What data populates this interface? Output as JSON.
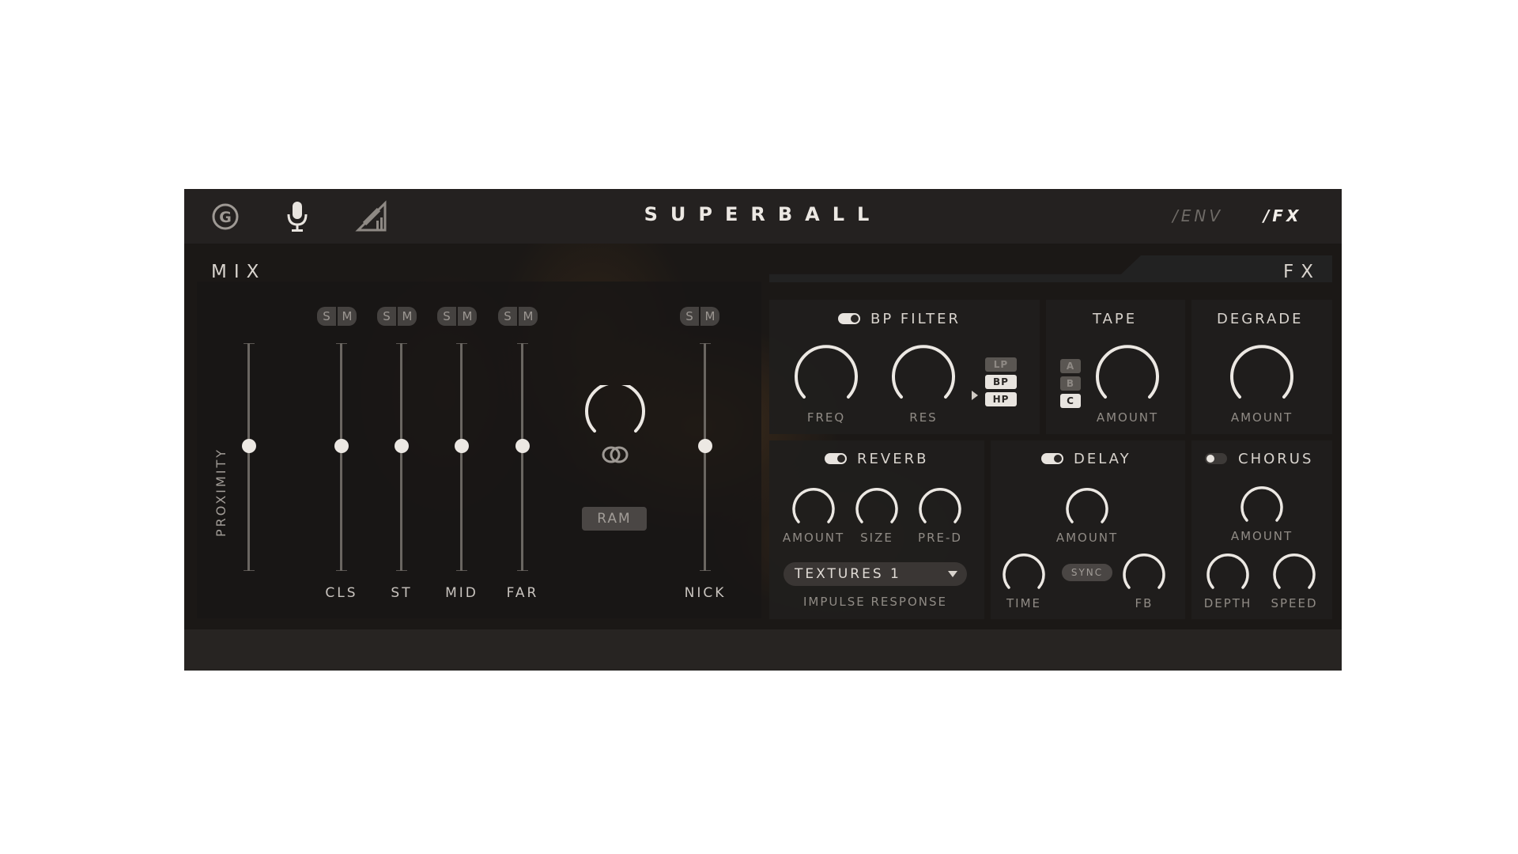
{
  "header": {
    "title": "SUPERBALL",
    "logo_icon": "g-logo-icon",
    "mic_icon": "microphone-icon",
    "tool_icon": "pencil-ruler-icon",
    "nav": [
      "/ENV",
      "/FX"
    ],
    "active_nav": "/FX"
  },
  "mix": {
    "title": "MIX",
    "proximity_label": "PROXIMITY",
    "solo_label": "S",
    "mute_label": "M",
    "faders": [
      {
        "label": "CLS",
        "level": 0.56
      },
      {
        "label": "ST",
        "level": 0.56
      },
      {
        "label": "MID",
        "level": 0.56
      },
      {
        "label": "FAR",
        "level": 0.56
      },
      {
        "label": "NICK",
        "level": 0.56
      }
    ],
    "proximity_level": 0.56,
    "ram_label": "RAM"
  },
  "fx": {
    "title": "FX",
    "bp_filter": {
      "title": "BP FILTER",
      "enabled": true,
      "knobs": [
        "FREQ",
        "RES"
      ],
      "modes": [
        "LP",
        "BP",
        "HP"
      ],
      "selected_modes": [
        "BP",
        "HP"
      ]
    },
    "tape": {
      "title": "TAPE",
      "options": [
        "A",
        "B",
        "C"
      ],
      "selected": "C",
      "knob": "AMOUNT"
    },
    "degrade": {
      "title": "DEGRADE",
      "knob": "AMOUNT"
    },
    "reverb": {
      "title": "REVERB",
      "enabled": true,
      "knobs": [
        "AMOUNT",
        "SIZE",
        "PRE-D"
      ],
      "impulse_value": "TEXTURES 1",
      "impulse_label": "IMPULSE RESPONSE"
    },
    "delay": {
      "title": "DELAY",
      "enabled": true,
      "knobs": [
        "AMOUNT",
        "TIME",
        "FB"
      ],
      "sync_label": "SYNC"
    },
    "chorus": {
      "title": "CHORUS",
      "enabled": false,
      "knobs": [
        "AMOUNT",
        "DEPTH",
        "SPEED"
      ]
    }
  },
  "colors": {
    "panel": "#1b1816",
    "topbar": "#242120",
    "accent": "#ece8e3",
    "smoke": "#8a5a28"
  }
}
